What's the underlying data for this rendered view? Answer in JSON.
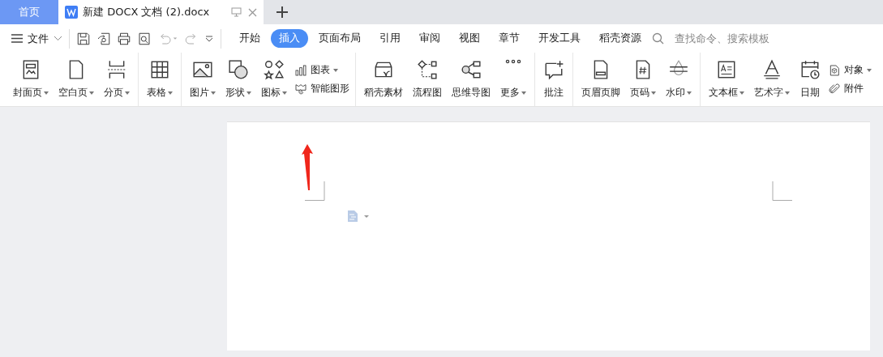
{
  "tabs": [
    {
      "label": "首页",
      "kind": "home",
      "selected": false
    },
    {
      "label": "新建 DOCX 文档 (2).docx",
      "kind": "document",
      "selected": true
    }
  ],
  "file_menu": {
    "label": "文件"
  },
  "ribbon_tabs": [
    {
      "label": "开始",
      "selected": false
    },
    {
      "label": "插入",
      "selected": true
    },
    {
      "label": "页面布局",
      "selected": false
    },
    {
      "label": "引用",
      "selected": false
    },
    {
      "label": "审阅",
      "selected": false
    },
    {
      "label": "视图",
      "selected": false
    },
    {
      "label": "章节",
      "selected": false
    },
    {
      "label": "开发工具",
      "selected": false
    },
    {
      "label": "稻壳资源",
      "selected": false
    }
  ],
  "search": {
    "placeholder": "查找命令、搜索模板"
  },
  "ribbon_groups": [
    {
      "items": [
        {
          "kind": "large",
          "label": "封面页",
          "caret": true
        },
        {
          "kind": "large",
          "label": "空白页",
          "caret": true
        },
        {
          "kind": "large",
          "label": "分页",
          "caret": true
        }
      ]
    },
    {
      "items": [
        {
          "kind": "large",
          "label": "表格",
          "caret": true
        }
      ]
    },
    {
      "items": [
        {
          "kind": "large",
          "label": "图片",
          "caret": true
        },
        {
          "kind": "large",
          "label": "形状",
          "caret": true
        },
        {
          "kind": "large",
          "label": "图标",
          "caret": true
        },
        {
          "kind": "stack",
          "items": [
            {
              "label": "图表",
              "caret": true
            },
            {
              "label": "智能图形",
              "caret": false
            }
          ]
        }
      ]
    },
    {
      "items": [
        {
          "kind": "large",
          "label": "稻壳素材",
          "caret": false
        },
        {
          "kind": "large",
          "label": "流程图",
          "caret": false
        },
        {
          "kind": "large",
          "label": "思维导图",
          "caret": false
        },
        {
          "kind": "large",
          "label": "更多",
          "caret": true
        }
      ]
    },
    {
      "items": [
        {
          "kind": "large",
          "label": "批注",
          "caret": false
        }
      ]
    },
    {
      "items": [
        {
          "kind": "large",
          "label": "页眉页脚",
          "caret": false
        },
        {
          "kind": "large",
          "label": "页码",
          "caret": true
        },
        {
          "kind": "large",
          "label": "水印",
          "caret": true
        }
      ]
    },
    {
      "items": [
        {
          "kind": "large",
          "label": "文本框",
          "caret": true
        },
        {
          "kind": "large",
          "label": "艺术字",
          "caret": true
        },
        {
          "kind": "large",
          "label": "日期",
          "caret": false
        },
        {
          "kind": "stack",
          "items": [
            {
              "label": "对象",
              "caret": true
            },
            {
              "label": "附件",
              "caret": false
            }
          ]
        }
      ]
    }
  ]
}
